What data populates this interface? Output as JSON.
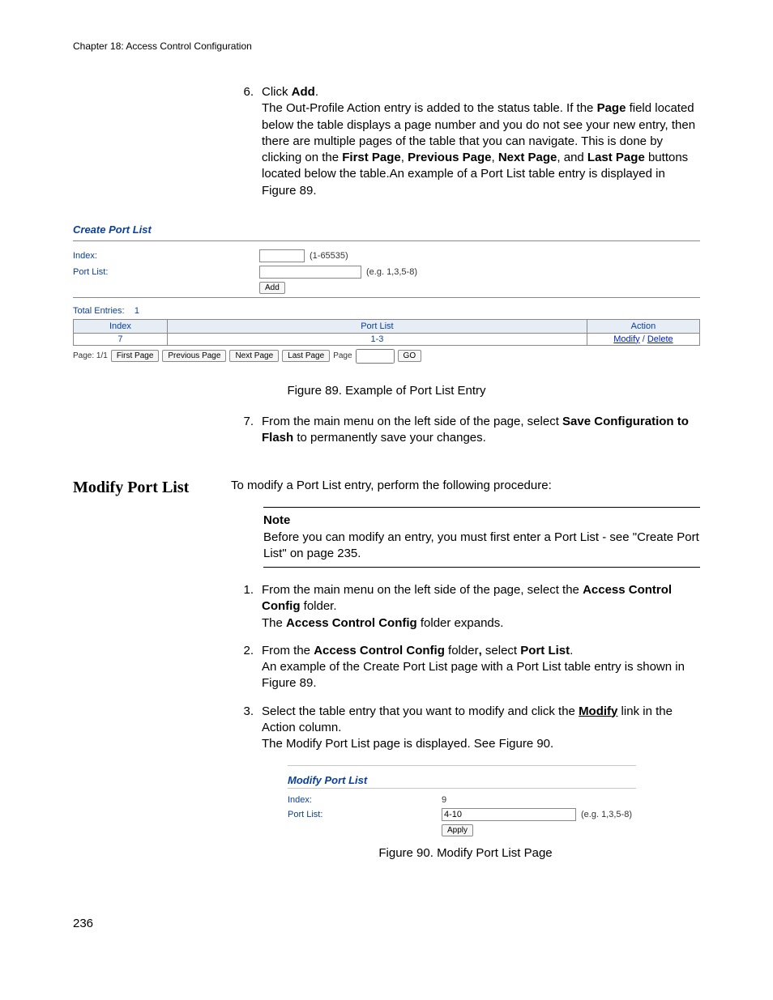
{
  "chapter_header": "Chapter 18: Access Control Configuration",
  "step6": {
    "num": "6.",
    "line1_pre": "Click ",
    "line1_bold": "Add",
    "line1_post": ".",
    "para_a": "The Out-Profile Action entry is added to the status table. If the ",
    "para_b_bold": "Page",
    "para_c": " field located below the table displays a page number and you do not see your new entry, then there are multiple pages of the table that you can navigate. This is done by clicking on the ",
    "para_d_bold": "First Page",
    "para_e": ", ",
    "para_f_bold": "Previous Page",
    "para_g": ", ",
    "para_h_bold": "Next Page",
    "para_i": ", and ",
    "para_j_bold": "Last Page",
    "para_k": " buttons located below the table.An example of a Port List table entry is displayed in Figure 89."
  },
  "create_panel": {
    "title": "Create Port List",
    "index_label": "Index:",
    "index_hint": "(1-65535)",
    "portlist_label": "Port List:",
    "portlist_hint": "(e.g. 1,3,5-8)",
    "add_btn": "Add",
    "total_entries_label": "Total Entries:",
    "total_entries_value": "1",
    "cols": {
      "index": "Index",
      "portlist": "Port List",
      "action": "Action"
    },
    "row": {
      "index": "7",
      "portlist": "1-3",
      "modify": "Modify",
      "sep": " / ",
      "delete": "Delete"
    },
    "pager": {
      "page_label": "Page: 1/1",
      "first": "First Page",
      "prev": "Previous Page",
      "next": "Next Page",
      "last": "Last Page",
      "page_word": "Page",
      "go": "GO"
    }
  },
  "fig89_caption": "Figure 89. Example of Port List Entry",
  "step7": {
    "num": "7.",
    "a": "From the main menu on the left side of the page, select ",
    "b_bold": "Save Configuration to Flash",
    "c": " to permanently save your changes."
  },
  "modify_heading": "Modify Port List",
  "modify_intro": "To modify a Port List entry, perform the following procedure:",
  "note": {
    "title": "Note",
    "body": "Before you can modify an entry, you must first enter a Port List - see \"Create Port List\" on page 235."
  },
  "m1": {
    "num": "1.",
    "a": "From the main menu on the left side of the page, select the ",
    "b_bold": "Access Control Config",
    "c": " folder.",
    "d": "The ",
    "e_bold": "Access Control Config",
    "f": " folder expands."
  },
  "m2": {
    "num": "2.",
    "a": "From the ",
    "b_bold": "Access Control Config",
    "c": " folder",
    "comma_bold": ",",
    "d": " select ",
    "e_bold": "Port List",
    "f": ".",
    "g": "An example of the Create Port List page with a Port List table entry is shown in Figure 89."
  },
  "m3": {
    "num": "3.",
    "a": "Select the table entry that you want to modify and click the ",
    "b_link": "Modify",
    "c": " link in the Action column.",
    "d": "The Modify Port List page is displayed. See Figure 90."
  },
  "modify_panel": {
    "title": "Modify Port List",
    "index_label": "Index:",
    "index_value": "9",
    "portlist_label": "Port List:",
    "portlist_value": "4-10",
    "portlist_hint": "(e.g. 1,3,5-8)",
    "apply_btn": "Apply"
  },
  "fig90_caption": "Figure 90. Modify Port List Page",
  "page_number": "236"
}
